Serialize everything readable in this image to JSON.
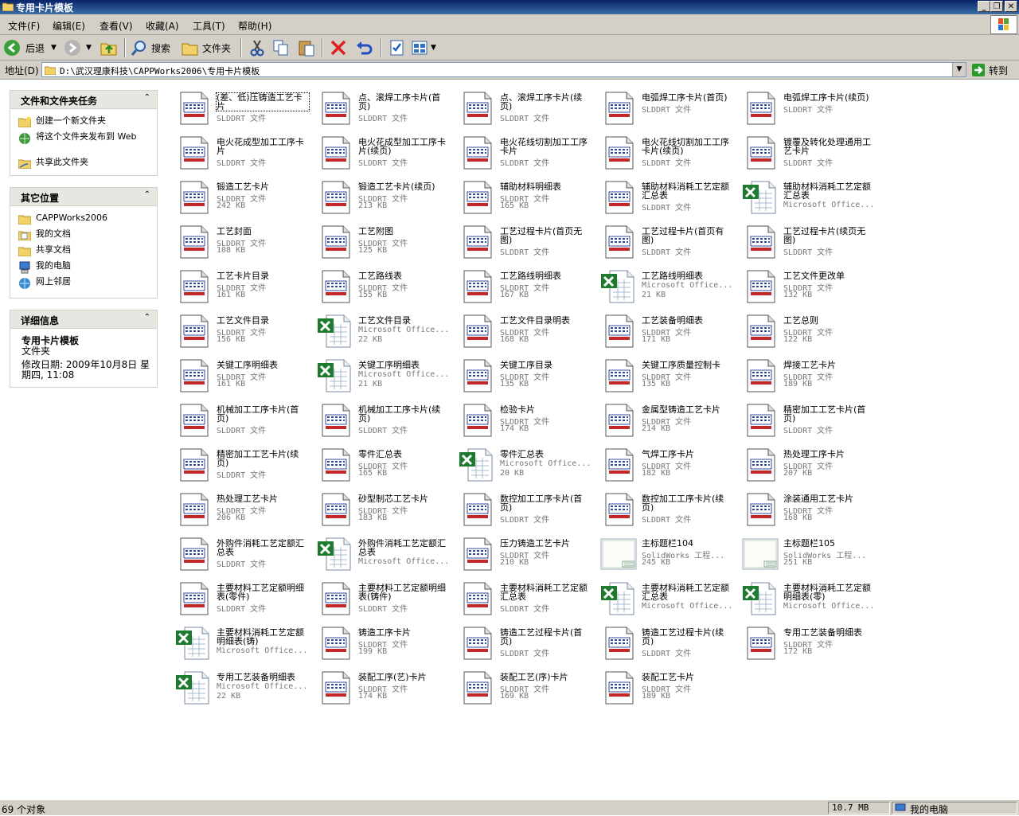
{
  "window": {
    "title": "专用卡片模板"
  },
  "menu": [
    {
      "label": "文件(F)"
    },
    {
      "label": "编辑(E)"
    },
    {
      "label": "查看(V)"
    },
    {
      "label": "收藏(A)"
    },
    {
      "label": "工具(T)"
    },
    {
      "label": "帮助(H)"
    }
  ],
  "toolbar": {
    "back": "后退",
    "search": "搜索",
    "folders": "文件夹"
  },
  "address": {
    "label": "地址(D)",
    "path": "D:\\武汉理康科技\\CAPPWorks2006\\专用卡片模板",
    "go": "转到"
  },
  "tasks": {
    "title": "文件和文件夹任务",
    "items": [
      {
        "label": "创建一个新文件夹",
        "icon": "new-folder-icon"
      },
      {
        "label": "将这个文件夹发布到 Web",
        "icon": "web-publish-icon"
      },
      {
        "label": "共享此文件夹",
        "icon": "share-folder-icon"
      }
    ]
  },
  "places": {
    "title": "其它位置",
    "items": [
      {
        "label": "CAPPWorks2006",
        "icon": "folder-icon"
      },
      {
        "label": "我的文档",
        "icon": "my-documents-icon"
      },
      {
        "label": "共享文档",
        "icon": "shared-documents-icon"
      },
      {
        "label": "我的电脑",
        "icon": "my-computer-icon"
      },
      {
        "label": "网上邻居",
        "icon": "network-icon"
      }
    ]
  },
  "details": {
    "title": "详细信息",
    "name": "专用卡片模板",
    "type": "文件夹",
    "modified": "修改日期: 2009年10月8日 星期四, 11:08"
  },
  "files": [
    {
      "name": "(差、低)压铸造工艺卡片",
      "type": "SLDDRT 文件",
      "size": "",
      "kind": "slddrt"
    },
    {
      "name": "点、滚焊工序卡片(首页)",
      "type": "SLDDRT 文件",
      "size": "",
      "kind": "slddrt"
    },
    {
      "name": "点、滚焊工序卡片(续页)",
      "type": "SLDDRT 文件",
      "size": "",
      "kind": "slddrt"
    },
    {
      "name": "电弧焊工序卡片(首页)",
      "type": "SLDDRT 文件",
      "size": "",
      "kind": "slddrt"
    },
    {
      "name": "电弧焊工序卡片(续页)",
      "type": "SLDDRT 文件",
      "size": "",
      "kind": "slddrt"
    },
    {
      "name": "电火花成型加工工序卡片",
      "type": "SLDDRT 文件",
      "size": "",
      "kind": "slddrt"
    },
    {
      "name": "电火花成型加工工序卡片(续页)",
      "type": "SLDDRT 文件",
      "size": "",
      "kind": "slddrt"
    },
    {
      "name": "电火花线切割加工工序卡片",
      "type": "SLDDRT 文件",
      "size": "",
      "kind": "slddrt"
    },
    {
      "name": "电火花线切割加工工序卡片(续页)",
      "type": "SLDDRT 文件",
      "size": "",
      "kind": "slddrt"
    },
    {
      "name": "镀覆及转化处理通用工艺卡片",
      "type": "SLDDRT 文件",
      "size": "",
      "kind": "slddrt"
    },
    {
      "name": "锻造工艺卡片",
      "type": "SLDDRT 文件",
      "size": "242 KB",
      "kind": "slddrt"
    },
    {
      "name": "锻造工艺卡片(续页)",
      "type": "SLDDRT 文件",
      "size": "213 KB",
      "kind": "slddrt"
    },
    {
      "name": "辅助材料明细表",
      "type": "SLDDRT 文件",
      "size": "165 KB",
      "kind": "slddrt"
    },
    {
      "name": "辅助材料消耗工艺定额汇总表",
      "type": "SLDDRT 文件",
      "size": "",
      "kind": "slddrt"
    },
    {
      "name": "辅助材料消耗工艺定额汇总表",
      "type": "Microsoft Office...",
      "size": "",
      "kind": "excel"
    },
    {
      "name": "工艺封面",
      "type": "SLDDRT 文件",
      "size": "108 KB",
      "kind": "slddrt"
    },
    {
      "name": "工艺附图",
      "type": "SLDDRT 文件",
      "size": "125 KB",
      "kind": "slddrt"
    },
    {
      "name": "工艺过程卡片(首页无图)",
      "type": "SLDDRT 文件",
      "size": "",
      "kind": "slddrt"
    },
    {
      "name": "工艺过程卡片(首页有图)",
      "type": "SLDDRT 文件",
      "size": "",
      "kind": "slddrt"
    },
    {
      "name": "工艺过程卡片(续页无图)",
      "type": "SLDDRT 文件",
      "size": "",
      "kind": "slddrt"
    },
    {
      "name": "工艺卡片目录",
      "type": "SLDDRT 文件",
      "size": "161 KB",
      "kind": "slddrt"
    },
    {
      "name": "工艺路线表",
      "type": "SLDDRT 文件",
      "size": "155 KB",
      "kind": "slddrt"
    },
    {
      "name": "工艺路线明细表",
      "type": "SLDDRT 文件",
      "size": "167 KB",
      "kind": "slddrt"
    },
    {
      "name": "工艺路线明细表",
      "type": "Microsoft Office...",
      "size": "21 KB",
      "kind": "excel"
    },
    {
      "name": "工艺文件更改单",
      "type": "SLDDRT 文件",
      "size": "132 KB",
      "kind": "slddrt"
    },
    {
      "name": "工艺文件目录",
      "type": "SLDDRT 文件",
      "size": "156 KB",
      "kind": "slddrt"
    },
    {
      "name": "工艺文件目录",
      "type": "Microsoft Office...",
      "size": "22 KB",
      "kind": "excel"
    },
    {
      "name": "工艺文件目录明表",
      "type": "SLDDRT 文件",
      "size": "168 KB",
      "kind": "slddrt"
    },
    {
      "name": "工艺装备明细表",
      "type": "SLDDRT 文件",
      "size": "171 KB",
      "kind": "slddrt"
    },
    {
      "name": "工艺总则",
      "type": "SLDDRT 文件",
      "size": "122 KB",
      "kind": "slddrt"
    },
    {
      "name": "关键工序明细表",
      "type": "SLDDRT 文件",
      "size": "161 KB",
      "kind": "slddrt"
    },
    {
      "name": "关键工序明细表",
      "type": "Microsoft Office...",
      "size": "21 KB",
      "kind": "excel"
    },
    {
      "name": "关键工序目录",
      "type": "SLDDRT 文件",
      "size": "135 KB",
      "kind": "slddrt"
    },
    {
      "name": "关键工序质量控制卡",
      "type": "SLDDRT 文件",
      "size": "135 KB",
      "kind": "slddrt"
    },
    {
      "name": "焊接工艺卡片",
      "type": "SLDDRT 文件",
      "size": "189 KB",
      "kind": "slddrt"
    },
    {
      "name": "机械加工工序卡片(首页)",
      "type": "SLDDRT 文件",
      "size": "",
      "kind": "slddrt"
    },
    {
      "name": "机械加工工序卡片(续页)",
      "type": "SLDDRT 文件",
      "size": "",
      "kind": "slddrt"
    },
    {
      "name": "检验卡片",
      "type": "SLDDRT 文件",
      "size": "174 KB",
      "kind": "slddrt"
    },
    {
      "name": "金属型铸造工艺卡片",
      "type": "SLDDRT 文件",
      "size": "214 KB",
      "kind": "slddrt"
    },
    {
      "name": "精密加工工艺卡片(首页)",
      "type": "SLDDRT 文件",
      "size": "",
      "kind": "slddrt"
    },
    {
      "name": "精密加工工艺卡片(续页)",
      "type": "SLDDRT 文件",
      "size": "",
      "kind": "slddrt"
    },
    {
      "name": "零件汇总表",
      "type": "SLDDRT 文件",
      "size": "165 KB",
      "kind": "slddrt"
    },
    {
      "name": "零件汇总表",
      "type": "Microsoft Office...",
      "size": "20 KB",
      "kind": "excel"
    },
    {
      "name": "气焊工序卡片",
      "type": "SLDDRT 文件",
      "size": "182 KB",
      "kind": "slddrt"
    },
    {
      "name": "热处理工序卡片",
      "type": "SLDDRT 文件",
      "size": "207 KB",
      "kind": "slddrt"
    },
    {
      "name": "热处理工艺卡片",
      "type": "SLDDRT 文件",
      "size": "206 KB",
      "kind": "slddrt"
    },
    {
      "name": "砂型制芯工艺卡片",
      "type": "SLDDRT 文件",
      "size": "183 KB",
      "kind": "slddrt"
    },
    {
      "name": "数控加工工序卡片(首页)",
      "type": "SLDDRT 文件",
      "size": "",
      "kind": "slddrt"
    },
    {
      "name": "数控加工工序卡片(续页)",
      "type": "SLDDRT 文件",
      "size": "",
      "kind": "slddrt"
    },
    {
      "name": "涂装通用工艺卡片",
      "type": "SLDDRT 文件",
      "size": "168 KB",
      "kind": "slddrt"
    },
    {
      "name": "外购件消耗工艺定额汇总表",
      "type": "SLDDRT 文件",
      "size": "",
      "kind": "slddrt"
    },
    {
      "name": "外购件消耗工艺定额汇总表",
      "type": "Microsoft Office...",
      "size": "",
      "kind": "excel"
    },
    {
      "name": "压力铸造工艺卡片",
      "type": "SLDDRT 文件",
      "size": "210 KB",
      "kind": "slddrt"
    },
    {
      "name": "主标题栏104",
      "type": "SolidWorks 工程...",
      "size": "245 KB",
      "kind": "solidworks"
    },
    {
      "name": "主标题栏105",
      "type": "SolidWorks 工程...",
      "size": "251 KB",
      "kind": "solidworks"
    },
    {
      "name": "主要材料工艺定额明细表(零件)",
      "type": "SLDDRT 文件",
      "size": "",
      "kind": "slddrt"
    },
    {
      "name": "主要材料工艺定额明细表(铸件)",
      "type": "SLDDRT 文件",
      "size": "",
      "kind": "slddrt"
    },
    {
      "name": "主要材料消耗工艺定额汇总表",
      "type": "SLDDRT 文件",
      "size": "",
      "kind": "slddrt"
    },
    {
      "name": "主要材料消耗工艺定额汇总表",
      "type": "Microsoft Office...",
      "size": "",
      "kind": "excel"
    },
    {
      "name": "主要材料消耗工艺定额明细表(零)",
      "type": "Microsoft Office...",
      "size": "",
      "kind": "excel"
    },
    {
      "name": "主要材料消耗工艺定额明细表(铸)",
      "type": "Microsoft Office...",
      "size": "",
      "kind": "excel"
    },
    {
      "name": "铸造工序卡片",
      "type": "SLDDRT 文件",
      "size": "199 KB",
      "kind": "slddrt"
    },
    {
      "name": "铸造工艺过程卡片(首页)",
      "type": "SLDDRT 文件",
      "size": "",
      "kind": "slddrt"
    },
    {
      "name": "铸造工艺过程卡片(续页)",
      "type": "SLDDRT 文件",
      "size": "",
      "kind": "slddrt"
    },
    {
      "name": "专用工艺装备明细表",
      "type": "SLDDRT 文件",
      "size": "172 KB",
      "kind": "slddrt"
    },
    {
      "name": "专用工艺装备明细表",
      "type": "Microsoft Office...",
      "size": "22 KB",
      "kind": "excel"
    },
    {
      "name": "装配工序(艺)卡片",
      "type": "SLDDRT 文件",
      "size": "174 KB",
      "kind": "slddrt"
    },
    {
      "name": "装配工艺(序)卡片",
      "type": "SLDDRT 文件",
      "size": "169 KB",
      "kind": "slddrt"
    },
    {
      "name": "装配工艺卡片",
      "type": "SLDDRT 文件",
      "size": "189 KB",
      "kind": "slddrt"
    }
  ],
  "status": {
    "count": "69 个对象",
    "size": "10.7 MB",
    "location": "我的电脑"
  }
}
